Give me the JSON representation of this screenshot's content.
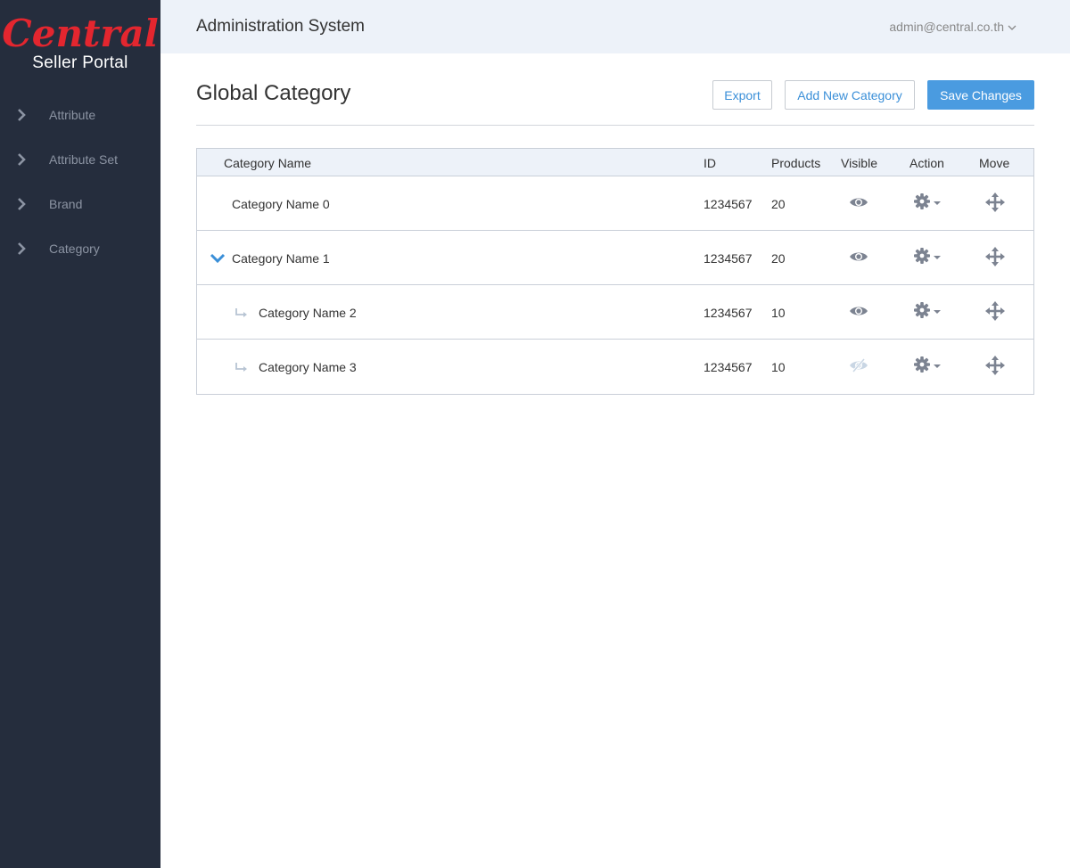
{
  "sidebar": {
    "logo_text": "Central",
    "logo_subtitle": "Seller Portal",
    "items": [
      {
        "label": "Attribute"
      },
      {
        "label": "Attribute Set"
      },
      {
        "label": "Brand"
      },
      {
        "label": "Category"
      }
    ]
  },
  "header": {
    "title": "Administration System",
    "user_email": "admin@central.co.th"
  },
  "page": {
    "title": "Global Category",
    "buttons": {
      "export": "Export",
      "add": "Add New Category",
      "save": "Save Changes"
    }
  },
  "table": {
    "columns": {
      "name": "Category Name",
      "id": "ID",
      "products": "Products",
      "visible": "Visible",
      "action": "Action",
      "move": "Move"
    },
    "rows": [
      {
        "name": "Category Name 0",
        "id": "1234567",
        "products": "20",
        "visible": true,
        "level": 0,
        "expanded": false
      },
      {
        "name": "Category Name 1",
        "id": "1234567",
        "products": "20",
        "visible": true,
        "level": 0,
        "expanded": true
      },
      {
        "name": "Category Name 2",
        "id": "1234567",
        "products": "10",
        "visible": true,
        "level": 1
      },
      {
        "name": "Category Name 3",
        "id": "1234567",
        "products": "10",
        "visible": false,
        "level": 1
      }
    ]
  },
  "colors": {
    "sidebar_bg": "#252d3d",
    "topbar_bg": "#edf2f9",
    "brand_red": "#e3262f",
    "accent_blue": "#4a9be0",
    "icon_gray": "#7c8391",
    "icon_hidden": "#c9d6e4"
  }
}
